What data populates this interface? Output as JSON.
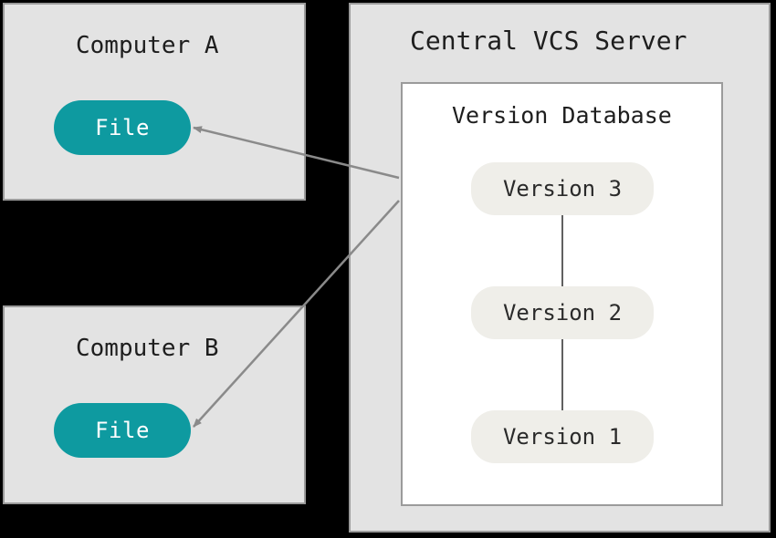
{
  "diagram": {
    "computerA": {
      "title": "Computer A",
      "file_label": "File"
    },
    "computerB": {
      "title": "Computer B",
      "file_label": "File"
    },
    "server": {
      "title": "Central VCS Server",
      "database_title": "Version Database",
      "versions": [
        "Version 3",
        "Version 2",
        "Version 1"
      ]
    }
  },
  "colors": {
    "panel_bg": "#e3e3e3",
    "panel_border": "#9b9b9b",
    "file_pill": "#0e9aa0",
    "version_pill": "#efeee9",
    "connector": "#606060"
  }
}
